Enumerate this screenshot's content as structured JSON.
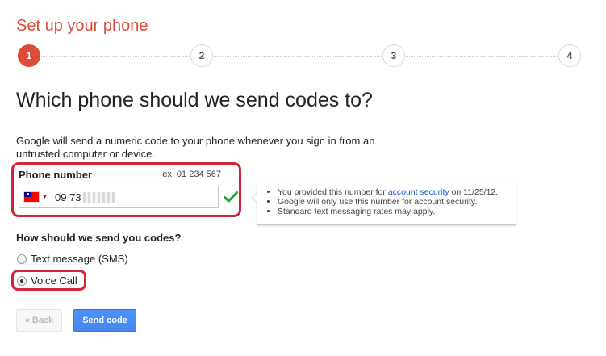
{
  "page_title": "Set up your phone",
  "stepper": {
    "steps": [
      "1",
      "2",
      "3",
      "4"
    ],
    "active_step": "1"
  },
  "heading": "Which phone should we send codes to?",
  "description": "Google will send a numeric code to your phone whenever you sign in from an untrusted computer or device.",
  "phone": {
    "label": "Phone number",
    "example": "ex: 01 234 567",
    "country_flag_icon": "taiwan-flag-icon",
    "value_visible": "09 73",
    "validated_icon": "checkmark-icon"
  },
  "tooltip": {
    "line1_prefix": "You provided this number for ",
    "line1_link": "account security",
    "line1_suffix": " on 11/25/12.",
    "line2": "Google will only use this number for account security.",
    "line3": "Standard text messaging rates may apply."
  },
  "method": {
    "question": "How should we send you codes?",
    "options": [
      {
        "label": "Text message (SMS)",
        "selected": false
      },
      {
        "label": "Voice Call",
        "selected": true
      }
    ]
  },
  "buttons": {
    "back_label": "« Back",
    "send_label": "Send code"
  },
  "colors": {
    "title_red": "#dd4b39",
    "highlight_red": "#d0273a",
    "primary_blue": "#4d90fe",
    "check_green": "#2aa036",
    "link_blue": "#1155cc"
  }
}
